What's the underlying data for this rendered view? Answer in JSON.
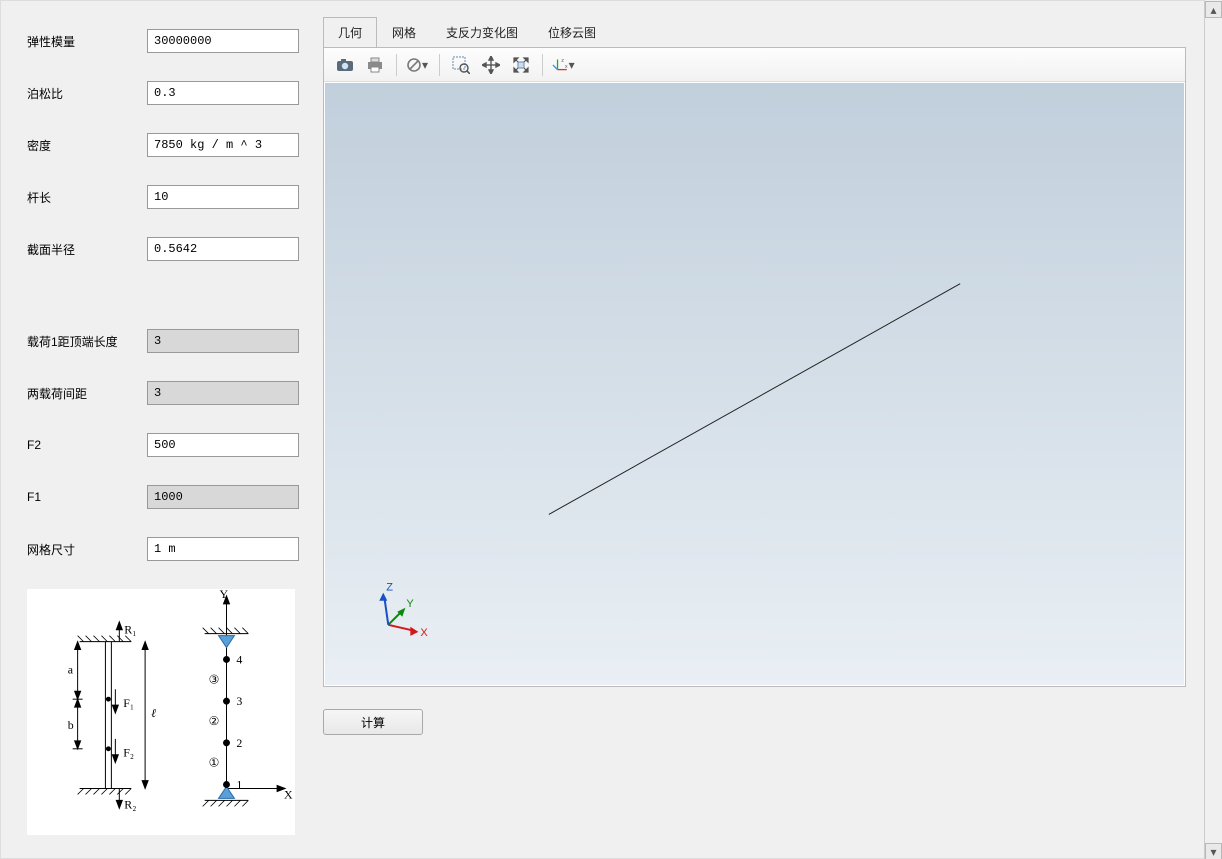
{
  "left": {
    "fields": {
      "elastic_modulus": {
        "label": "弹性模量",
        "value": "30000000",
        "readonly": false
      },
      "poisson": {
        "label": "泊松比",
        "value": "0.3",
        "readonly": false
      },
      "density": {
        "label": "密度",
        "value": "7850 kg / m ^ 3",
        "readonly": false
      },
      "bar_length": {
        "label": "杆长",
        "value": "10",
        "readonly": false
      },
      "radius": {
        "label": "截面半径",
        "value": "0.5642",
        "readonly": false
      },
      "load1_offset": {
        "label": "载荷1距顶端长度",
        "value": "3",
        "readonly": true
      },
      "load_spacing": {
        "label": "两载荷间距",
        "value": "3",
        "readonly": true
      },
      "F2": {
        "label": "F2",
        "value": "500",
        "readonly": false
      },
      "F1": {
        "label": "F1",
        "value": "1000",
        "readonly": true
      },
      "mesh_size": {
        "label": "网格尺寸",
        "value": "1 m",
        "readonly": false
      }
    },
    "diagram_labels": {
      "R1": "R₁",
      "R2": "R₂",
      "F1": "F₁",
      "F2": "F₂",
      "a": "a",
      "b": "b",
      "l": "ℓ",
      "X": "X",
      "Y": "Y",
      "n1": "1",
      "n2": "2",
      "n3": "3",
      "n4": "4",
      "e1": "①",
      "e2": "②",
      "e3": "③"
    }
  },
  "tabs": {
    "items": [
      {
        "id": "geom",
        "label": "几何",
        "active": true
      },
      {
        "id": "mesh",
        "label": "网格",
        "active": false
      },
      {
        "id": "react",
        "label": "支反力变化图",
        "active": false
      },
      {
        "id": "disp",
        "label": "位移云图",
        "active": false
      }
    ]
  },
  "toolbar": {
    "camera": "camera-icon",
    "print": "print-icon",
    "forbid": "cancel-select-icon",
    "zoombox": "zoom-box-icon",
    "pan": "pan-icon",
    "fit": "fit-extents-icon",
    "axes": "axes-orientation-icon"
  },
  "viewer": {
    "triad": {
      "X": "X",
      "Y": "Y",
      "Z": "Z"
    }
  },
  "actions": {
    "compute": "计算"
  }
}
